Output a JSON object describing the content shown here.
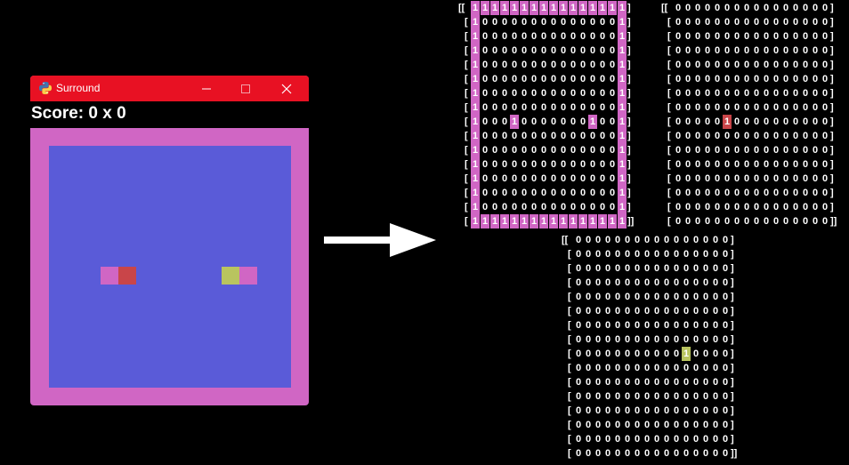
{
  "window": {
    "title": "Surround",
    "score_text": "Score: 0 x 0",
    "colors": {
      "titlebar": "#e81123",
      "wall": "#d066c4",
      "floor": "#5a5bd8",
      "player_red": "#c94549",
      "player_green": "#b9c45f"
    }
  },
  "icons": [
    "python-icon",
    "minimize-icon",
    "maximize-icon",
    "close-icon",
    "arrow-icon"
  ],
  "matrices": {
    "walls": {
      "rows": [
        "1111111111111111",
        "1000000000000001",
        "1000000000000001",
        "1000000000000001",
        "1000000000000001",
        "1000000000000001",
        "1000000000000001",
        "1000000000000001",
        "1000100000001001",
        "1000000000000001",
        "1000000000000001",
        "1000000000000001",
        "1000000000000001",
        "1000000000000001",
        "1000000000000001",
        "1111111111111111"
      ],
      "highlight_color": "#d066c4"
    },
    "player_red": {
      "rows": [
        "0000000000000000",
        "0000000000000000",
        "0000000000000000",
        "0000000000000000",
        "0000000000000000",
        "0000000000000000",
        "0000000000000000",
        "0000000000000000",
        "0000010000000000",
        "0000000000000000",
        "0000000000000000",
        "0000000000000000",
        "0000000000000000",
        "0000000000000000",
        "0000000000000000",
        "0000000000000000"
      ],
      "highlight_color": "#c94549"
    },
    "player_green": {
      "rows": [
        "0000000000000000",
        "0000000000000000",
        "0000000000000000",
        "0000000000000000",
        "0000000000000000",
        "0000000000000000",
        "0000000000000000",
        "0000000000000000",
        "0000000000010000",
        "0000000000000000",
        "0000000000000000",
        "0000000000000000",
        "0000000000000000",
        "0000000000000000",
        "0000000000000000",
        "0000000000000000"
      ],
      "highlight_color": "#b9c45f"
    }
  }
}
